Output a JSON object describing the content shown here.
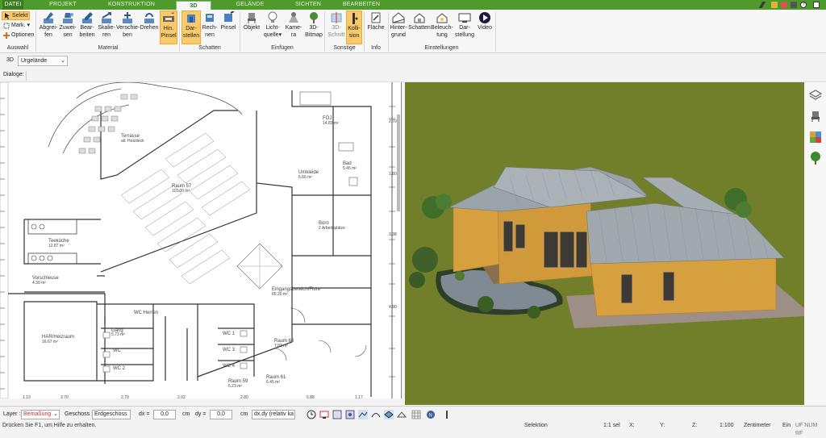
{
  "menu": {
    "tabs": [
      "DATEI",
      "PROJEKT",
      "KONSTRUKTION",
      "3D",
      "GELÄNDE",
      "SICHTEN",
      "BEARBEITEN"
    ],
    "active_tab": "3D"
  },
  "ribbon": {
    "auswahl": {
      "items": [
        "Selekt",
        "Mark.",
        "Optionen"
      ],
      "label": "Auswahl"
    },
    "material": {
      "buttons": [
        {
          "l1": "Abgrei-",
          "l2": "fen",
          "icon": "eyedropper-icon"
        },
        {
          "l1": "Zuwei-",
          "l2": "sen",
          "icon": "paint-bucket-icon"
        },
        {
          "l1": "Bear-",
          "l2": "beiten",
          "icon": "edit-material-icon"
        },
        {
          "l1": "Skalie-",
          "l2": "ren",
          "icon": "scale-icon"
        },
        {
          "l1": "Verschie-",
          "l2": "ben",
          "icon": "move-icon"
        },
        {
          "l1": "Drehen",
          "l2": "",
          "icon": "rotate-icon"
        },
        {
          "l1": "Hin.",
          "l2": "Pinsel",
          "icon": "brush-icon"
        }
      ],
      "label": "Material"
    },
    "schatten": {
      "buttons": [
        {
          "l1": "Dar-",
          "l2": "stellen",
          "icon": "shadow-display-icon"
        },
        {
          "l1": "Rech-",
          "l2": "nen",
          "icon": "shadow-calc-icon"
        },
        {
          "l1": "Pinsel",
          "l2": "",
          "icon": "shadow-brush-icon"
        }
      ],
      "label": "Schatten"
    },
    "einfuegen": {
      "buttons": [
        {
          "l1": "Objekt",
          "l2": "",
          "icon": "chair-icon"
        },
        {
          "l1": "Licht-",
          "l2": "quelle",
          "icon": "lightbulb-icon"
        },
        {
          "l1": "Kame-",
          "l2": "ra",
          "icon": "camera-icon"
        },
        {
          "l1": "3D-",
          "l2": "Bitmap",
          "icon": "tree-icon"
        }
      ],
      "label": "Einfügen"
    },
    "sonstige": {
      "buttons": [
        {
          "l1": "3D-",
          "l2": "Schnitt",
          "icon": "section-cut-icon"
        },
        {
          "l1": "Kolli-",
          "l2": "sion",
          "icon": "collision-icon"
        }
      ],
      "label": "Sonstige"
    },
    "info": {
      "buttons": [
        {
          "l1": "Fläche",
          "l2": "",
          "icon": "area-icon"
        }
      ],
      "label": "Info"
    },
    "einstellungen": {
      "buttons": [
        {
          "l1": "Hinter-",
          "l2": "grund",
          "icon": "background-icon"
        },
        {
          "l1": "Schatten",
          "l2": "",
          "icon": "house-shadow-icon"
        },
        {
          "l1": "Beleuch-",
          "l2": "tung",
          "icon": "house-light-icon"
        },
        {
          "l1": "Dar-",
          "l2": "stellung",
          "icon": "display-icon"
        },
        {
          "l1": "Video",
          "l2": "",
          "icon": "play-icon"
        }
      ],
      "label": "Einstellungen"
    }
  },
  "viewbar": {
    "mode": "3D",
    "layer": "Urgelände"
  },
  "dialog": {
    "label": "Dialoge:"
  },
  "plan": {
    "rooms": [
      {
        "name": "Terrasse",
        "sub": "alt. Holzdeck"
      },
      {
        "name": "Raum 57",
        "sub": "110.00 m²"
      },
      {
        "name": "FÖJ",
        "sub": "14.83 m²"
      },
      {
        "name": "Bad",
        "sub": "5.45 m²"
      },
      {
        "name": "Umkleide",
        "sub": "5.66 m²"
      },
      {
        "name": "Büro",
        "sub": "2 Arbeitsplätze"
      },
      {
        "name": "Teeküche",
        "sub": "12.87 m²"
      },
      {
        "name": "Vorschleuse",
        "sub": "4.30 m²"
      },
      {
        "name": "Eingangsbereich/Flure",
        "sub": "65.20 m²"
      },
      {
        "name": "HAR/Heizraum",
        "sub": "16.67 m²"
      },
      {
        "name": "WC Herren",
        "sub": ""
      },
      {
        "name": "Gang",
        "sub": "5.73 m²"
      },
      {
        "name": "WC",
        "sub": ""
      },
      {
        "name": "WC 2",
        "sub": ""
      },
      {
        "name": "WC 1",
        "sub": ""
      },
      {
        "name": "WC 3",
        "sub": ""
      },
      {
        "name": "WC 4",
        "sub": ""
      },
      {
        "name": "Raum 60",
        "sub": "7.83 m²"
      },
      {
        "name": "Raum 61",
        "sub": "6.45 m²"
      },
      {
        "name": "Raum 59",
        "sub": "6.23 m²"
      }
    ]
  },
  "sidebar_icons": [
    "layers-icon",
    "chair-icon",
    "palette-icon",
    "tree-icon"
  ],
  "toolbar": {
    "layer_label": "Layer :",
    "layer_value": "Bemaßung",
    "geschoss_label": "Geschoss :",
    "geschoss_value": "Erdgeschoss",
    "dx_label": "dx =",
    "dx_value": "0,0",
    "dy_label": "dy =",
    "dy_value": "0,0",
    "unit": "cm",
    "mode_value": "dx,dy (relativ ka"
  },
  "status": {
    "help": "Drücken Sie F1, um Hilfe zu erhalten.",
    "mode": "Selektion",
    "sel": "1:1 sel",
    "x": "X:",
    "y": "Y:",
    "z": "Z:",
    "scale": "1:100",
    "unit": "Zentimeter",
    "ein": "Ein",
    "flags": "UF NUM RF"
  },
  "colors": {
    "menubar": "#4e9a2d",
    "grass": "#717f2a",
    "wall": "#d6a03e",
    "roof": "#9aa3aa",
    "highlight": "#f9c96a"
  }
}
